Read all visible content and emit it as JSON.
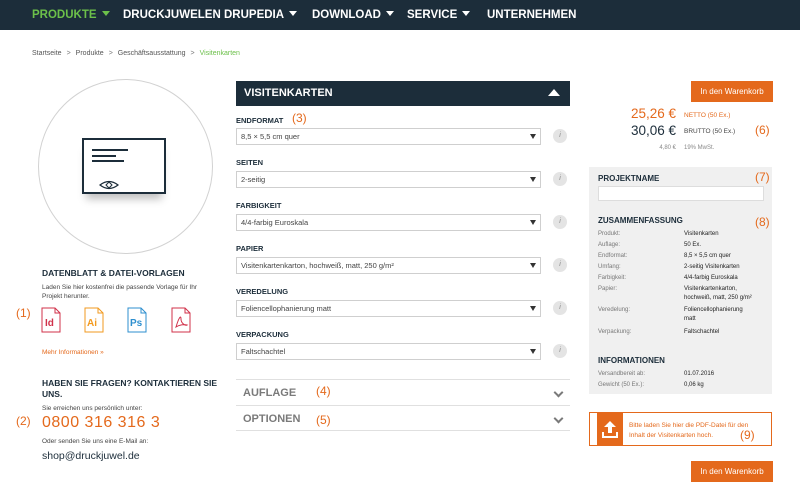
{
  "nav": {
    "items": [
      {
        "label": "PRODUKTE",
        "caret": true,
        "active": true
      },
      {
        "label": "DRUCKJUWELEN",
        "caret": false
      },
      {
        "label": "DRUPEDIA",
        "caret": true
      },
      {
        "label": "DOWNLOAD",
        "caret": true
      },
      {
        "label": "SERVICE",
        "caret": true
      },
      {
        "label": "UNTERNEHMEN",
        "caret": false
      }
    ]
  },
  "breadcrumb": {
    "items": [
      "Startseite",
      "Produkte",
      "Geschäftsausstattung"
    ],
    "separator": ">",
    "current": "Visitenkarten"
  },
  "left": {
    "datasheet": {
      "title": "DATENBLATT & DATEI-VORLAGEN",
      "text_line1": "Laden Sie hier kostenfrei die passende Vorlage für Ihr",
      "text_line2": "Projekt herunter.",
      "files": [
        {
          "label": "Id",
          "icon": "indesign-file-icon",
          "color": "#d0314a"
        },
        {
          "label": "Ai",
          "icon": "illustrator-file-icon",
          "color": "#f29a1f"
        },
        {
          "label": "Ps",
          "icon": "photoshop-file-icon",
          "color": "#2d8fcf"
        },
        {
          "label": "",
          "icon": "pdf-file-icon",
          "color": "#d0314a"
        }
      ],
      "more_link": "Mehr Informationen »"
    },
    "contact": {
      "title_line1": "HABEN SIE FRAGEN? KONTAKTIEREN SIE",
      "title_line2": "UNS.",
      "phone_intro": "Sie erreichen uns persönlich unter:",
      "phone": "0800 316 316 3",
      "email_intro": "Oder senden Sie uns eine E-Mail an:",
      "email": "shop@druckjuwel.de"
    }
  },
  "product": {
    "title": "VISITENKARTEN",
    "options": [
      {
        "label": "ENDFORMAT",
        "value": "8,5 × 5,5 cm quer",
        "annotation": "(3)"
      },
      {
        "label": "SEITEN",
        "value": "2-seitig"
      },
      {
        "label": "FARBIGKEIT",
        "value": "4/4-farbig Euroskala"
      },
      {
        "label": "PAPIER",
        "value": "Visitenkartenkarton, hochweiß, matt, 250 g/m²"
      },
      {
        "label": "VEREDELUNG",
        "value": "Foliencellophanierung matt"
      },
      {
        "label": "VERPACKUNG",
        "value": "Faltschachtel"
      }
    ],
    "info_glyph": "i",
    "accordions": [
      {
        "label": "AUFLAGE",
        "annotation": "(4)"
      },
      {
        "label": "OPTIONEN",
        "annotation": "(5)"
      }
    ]
  },
  "pricing": {
    "cart_button": "In den Warenkorb",
    "net_price": "25,26 €",
    "net_label": "NETTO (50 Ex.)",
    "gross_price": "30,06 €",
    "gross_label": "BRUTTO (50 Ex.)",
    "vat_amount": "4,80 €",
    "vat_label": "19% MwSt."
  },
  "summary": {
    "project_heading": "PROJEKTNAME",
    "summary_heading": "ZUSAMMENFASSUNG",
    "rows": [
      {
        "key": "Produkt:",
        "value": "Visitenkarten"
      },
      {
        "key": "Auflage:",
        "value": "50 Ex."
      },
      {
        "key": "Endformat:",
        "value": "8,5 × 5,5 cm quer"
      },
      {
        "key": "Umfang:",
        "value": "2-seitig Visitenkarten"
      },
      {
        "key": "Farbigkeit:",
        "value": "4/4-farbig Euroskala"
      },
      {
        "key": "Papier:",
        "value": "Visitenkartenkarton,",
        "value2": "hochweiß, matt, 250 g/m²"
      },
      {
        "key": "Veredelung:",
        "value": "Foliencellophanierung",
        "value2": "matt"
      },
      {
        "key": "Verpackung:",
        "value": "Faltschachtel"
      }
    ],
    "info_heading": "INFORMATIONEN",
    "info_rows": [
      {
        "key": "Versandbereit ab:",
        "value": "01.07.2016"
      },
      {
        "key": "Gewicht (50 Ex.):",
        "value": "0,06 kg"
      }
    ]
  },
  "upload": {
    "line1": "Bitte laden Sie hier die PDF-Datei für den",
    "line2": "Inhalt der Visitenkarten hoch.",
    "icon": "upload-icon"
  },
  "annotations": {
    "a1": "(1)",
    "a2": "(2)",
    "a6": "(6)",
    "a7": "(7)",
    "a8": "(8)",
    "a9": "(9)"
  },
  "colors": {
    "navy": "#1c2d3a",
    "accent": "#e4691c",
    "green": "#6cc04a"
  }
}
